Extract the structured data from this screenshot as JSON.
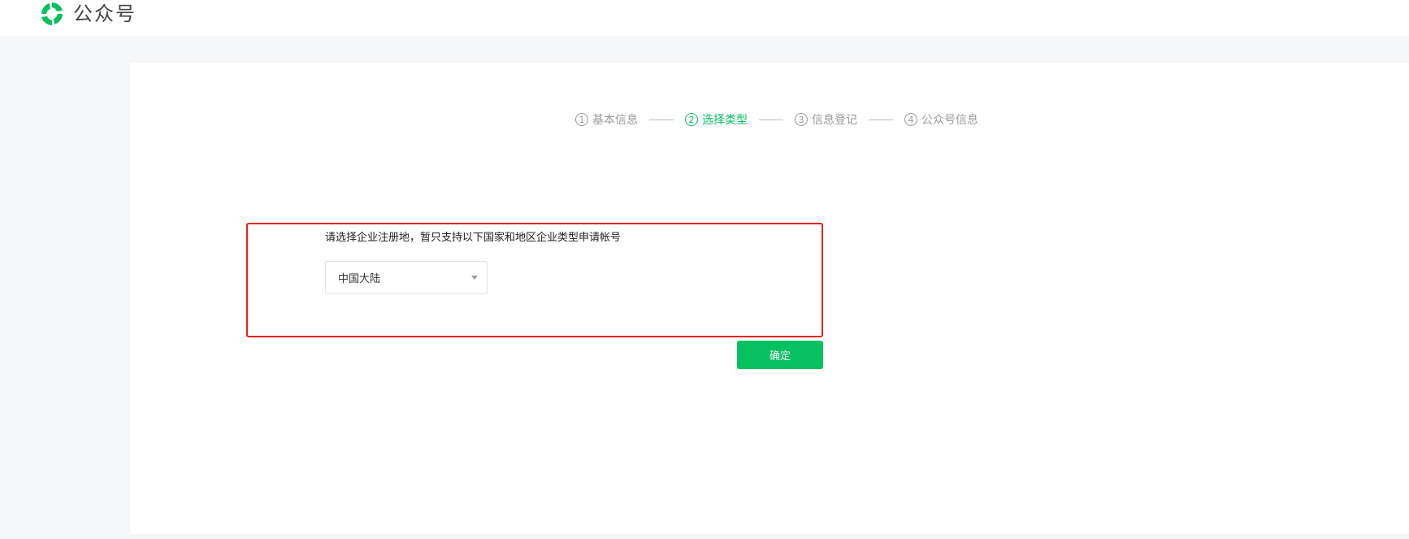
{
  "header": {
    "logo_icon": "wechat-official-accounts-logo",
    "title": "公众号"
  },
  "steps": [
    {
      "number": "1",
      "label": "基本信息",
      "active": false
    },
    {
      "number": "2",
      "label": "选择类型",
      "active": true
    },
    {
      "number": "3",
      "label": "信息登记",
      "active": false
    },
    {
      "number": "4",
      "label": "公众号信息",
      "active": false
    }
  ],
  "form": {
    "prompt": "请选择企业注册地，暂只支持以下国家和地区企业类型申请帐号",
    "region_select": {
      "value": "中国大陆",
      "icon": "chevron-down-icon"
    },
    "confirm_label": "确定"
  },
  "colors": {
    "accent": "#07c160",
    "highlight": "#e8211f",
    "inactive_text": "#9a9a9a"
  }
}
